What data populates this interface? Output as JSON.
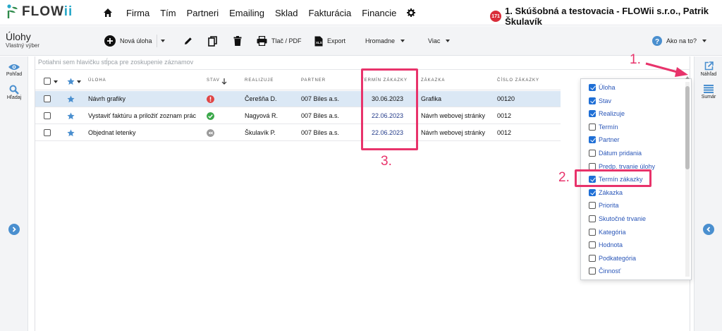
{
  "app": {
    "logo": {
      "prefix": "FLOW",
      "suffix": "ii"
    },
    "nav": [
      "Firma",
      "Tím",
      "Partneri",
      "Emailing",
      "Sklad",
      "Fakturácia",
      "Financie"
    ],
    "notifications": "171",
    "company": "1. Skúšobná a testovacia - FLOWii s.r.o., Patrik Škulavík"
  },
  "page": {
    "title": "Úlohy",
    "subtitle": "Vlastný výber"
  },
  "toolbar": {
    "new_task": "Nová úloha",
    "print": "Tlač / PDF",
    "export": "Export",
    "bulk": "Hromadne",
    "more": "Viac",
    "help": "Ako na to?"
  },
  "left_sidebar": {
    "view": "Pohľad",
    "search": "Hľadaj"
  },
  "right_sidebar": {
    "preview": "Náhľad",
    "summary": "Sumár"
  },
  "grid": {
    "group_hint": "Potiahni sem hlavičku stĺpca pre zoskupenie záznamov",
    "columns": {
      "task": "Úloha",
      "state": "Stav",
      "assignee": "Realizuje",
      "partner": "Partner",
      "deadline": "Termín zákazky",
      "order": "Zákazka",
      "order_no": "Číslo zákazky"
    },
    "rows": [
      {
        "task": "Návrh grafiky",
        "status": "alert",
        "assignee": "Čerešňa D.",
        "partner": "007 Biles a.s.",
        "deadline": "30.06.2023",
        "order": "Grafika",
        "order_no": "00120"
      },
      {
        "task": "Vystaviť faktúru a priložiť zoznam prác",
        "status": "done",
        "assignee": "Nagyová R.",
        "partner": "007 Biles a.s.",
        "deadline": "22.06.2023",
        "order": "Návrh webovej stránky",
        "order_no": "0012"
      },
      {
        "task": "Objednat letenky",
        "status": "paused",
        "assignee": "Škulavík P.",
        "partner": "007 Biles a.s.",
        "deadline": "22.06.2023",
        "order": "Návrh webovej stránky",
        "order_no": "0012"
      }
    ]
  },
  "column_chooser": [
    {
      "label": "Úloha",
      "checked": true
    },
    {
      "label": "Stav",
      "checked": true
    },
    {
      "label": "Realizuje",
      "checked": true
    },
    {
      "label": "Termín",
      "checked": false
    },
    {
      "label": "Partner",
      "checked": true
    },
    {
      "label": "Dátum pridania",
      "checked": false
    },
    {
      "label": "Predp. trvanie úlohy",
      "checked": false
    },
    {
      "label": "Termín zákazky",
      "checked": true
    },
    {
      "label": "Zákazka",
      "checked": true
    },
    {
      "label": "Priorita",
      "checked": false
    },
    {
      "label": "Skutočné trvanie",
      "checked": false
    },
    {
      "label": "Kategória",
      "checked": false
    },
    {
      "label": "Hodnota",
      "checked": false
    },
    {
      "label": "Podkategória",
      "checked": false
    },
    {
      "label": "Činnosť",
      "checked": false
    }
  ],
  "annotations": {
    "one": "1.",
    "two": "2.",
    "three": "3."
  },
  "colors": {
    "accent": "#e8336b",
    "link": "#2a56b8",
    "brand": "#26a8c8",
    "selected_row": "#dbe8f5"
  }
}
